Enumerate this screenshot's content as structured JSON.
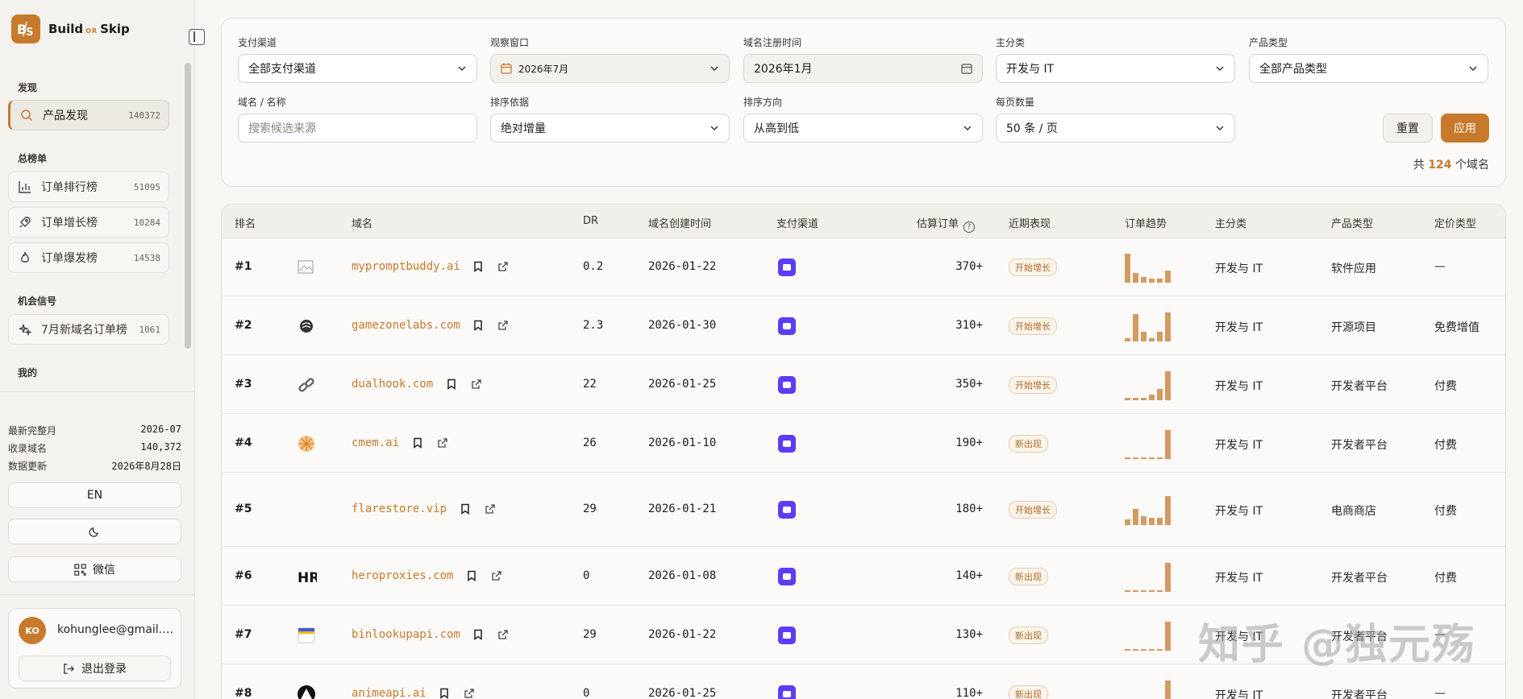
{
  "app": {
    "brand_build": "Build",
    "brand_or": "OR",
    "brand_skip": "Skip"
  },
  "sidebar": {
    "sections": [
      {
        "title": "发现",
        "items": [
          {
            "label": "产品发现",
            "count": "140372",
            "icon": "search-icon",
            "active": true
          }
        ]
      },
      {
        "title": "总榜单",
        "items": [
          {
            "label": "订单排行榜",
            "count": "51095",
            "icon": "bar-chart-icon"
          },
          {
            "label": "订单增长榜",
            "count": "10284",
            "icon": "rocket-icon"
          },
          {
            "label": "订单爆发榜",
            "count": "14538",
            "icon": "flame-icon"
          }
        ]
      },
      {
        "title": "机会信号",
        "items": [
          {
            "label": "7月新域名订单榜",
            "count": "1061",
            "icon": "sparkles-icon"
          }
        ]
      },
      {
        "title": "我的",
        "items": []
      }
    ],
    "meta": [
      {
        "label": "最新完整月",
        "value": "2026-07"
      },
      {
        "label": "收录域名",
        "value": "140,372"
      },
      {
        "label": "数据更新",
        "value": "2026年8月28日"
      }
    ],
    "lang_button": "EN",
    "wechat_button": "微信",
    "user": {
      "initials": "KO",
      "email": "kohunglee@gmail.c...",
      "logout": "退出登录"
    }
  },
  "filters": {
    "payment": {
      "label": "支付渠道",
      "value": "全部支付渠道"
    },
    "window": {
      "label": "观察窗口",
      "value": "2026年7月"
    },
    "reg_time": {
      "label": "域名注册时间",
      "value": "2026年1月"
    },
    "category": {
      "label": "主分类",
      "value": "开发与 IT"
    },
    "product_type": {
      "label": "产品类型",
      "value": "全部产品类型"
    },
    "name": {
      "label": "域名 / 名称",
      "placeholder": "搜索候选来源"
    },
    "sort_by": {
      "label": "排序依据",
      "value": "绝对增量"
    },
    "sort_dir": {
      "label": "排序方向",
      "value": "从高到低"
    },
    "page_size": {
      "label": "每页数量",
      "value": "50 条 / 页"
    },
    "reset": "重置",
    "apply": "应用",
    "total_prefix": "共",
    "total_count": "124",
    "total_suffix": "个域名"
  },
  "table": {
    "columns": [
      "排名",
      "域名",
      "DR",
      "域名创建时间",
      "支付渠道",
      "估算订单",
      "近期表现",
      "订单趋势",
      "主分类",
      "产品类型",
      "定价类型"
    ],
    "rows": [
      {
        "rank": "#1",
        "domain": "mypromptbuddy.ai",
        "favicon": "broken-image-icon",
        "dr": "0.2",
        "created": "2026-01-22",
        "orders": "370+",
        "perf": "开始增长",
        "trend": [
          1.0,
          0.33,
          0.2,
          0.13,
          0.13,
          0.43
        ],
        "category": "开发与 IT",
        "ptype": "软件应用",
        "pricing": "—"
      },
      {
        "rank": "#2",
        "domain": "gamezonelabs.com",
        "favicon": "swirl-icon",
        "dr": "2.3",
        "created": "2026-01-30",
        "orders": "310+",
        "perf": "开始增长",
        "trend": [
          0.1,
          0.95,
          0.33,
          0.1,
          0.33,
          1.0
        ],
        "category": "开发与 IT",
        "ptype": "开源项目",
        "pricing": "免费增值"
      },
      {
        "rank": "#3",
        "domain": "dualhook.com",
        "favicon": "link-icon",
        "dr": "22",
        "created": "2026-01-25",
        "orders": "350+",
        "perf": "开始增长",
        "trend": [
          0.05,
          0.05,
          0.05,
          0.2,
          0.4,
          1.0
        ],
        "category": "开发与 IT",
        "ptype": "开发者平台",
        "pricing": "付费"
      },
      {
        "rank": "#4",
        "domain": "cmem.ai",
        "favicon": "sunburst-icon",
        "dr": "26",
        "created": "2026-01-10",
        "orders": "190+",
        "perf": "新出现",
        "trend": [
          0,
          0,
          0,
          0,
          0,
          1.0
        ],
        "category": "开发与 IT",
        "ptype": "开发者平台",
        "pricing": "付费"
      },
      {
        "rank": "#5",
        "domain": "flarestore.vip",
        "favicon": "",
        "dr": "29",
        "created": "2026-01-21",
        "orders": "180+",
        "perf": "开始增长",
        "trend": [
          0.2,
          0.55,
          0.3,
          0.25,
          0.25,
          1.0
        ],
        "category": "开发与 IT",
        "ptype": "电商商店",
        "pricing": "付费"
      },
      {
        "rank": "#6",
        "domain": "heroproxies.com",
        "favicon": "hero-logo-icon",
        "dr": "0",
        "created": "2026-01-08",
        "orders": "140+",
        "perf": "新出现",
        "trend": [
          0,
          0,
          0,
          0,
          0,
          1.0
        ],
        "category": "开发与 IT",
        "ptype": "开发者平台",
        "pricing": "付费"
      },
      {
        "rank": "#7",
        "domain": "binlookupapi.com",
        "favicon": "card-icon",
        "dr": "29",
        "created": "2026-01-22",
        "orders": "130+",
        "perf": "新出现",
        "trend": [
          0,
          0,
          0,
          0,
          0,
          1.0
        ],
        "category": "开发与 IT",
        "ptype": "开发者平台",
        "pricing": "—"
      },
      {
        "rank": "#8",
        "domain": "animeapi.ai",
        "favicon": "triangle-icon",
        "dr": "0",
        "created": "2026-01-25",
        "orders": "110+",
        "perf": "新出现",
        "trend": [
          0,
          0,
          0,
          0,
          0,
          1.0
        ],
        "category": "开发与 IT",
        "ptype": "开发者平台",
        "pricing": "—"
      }
    ]
  },
  "watermark": "知乎 @独元殇",
  "colors": {
    "accent": "#c77a2c",
    "payment": "#5b3df5",
    "spark": "#d49a61"
  }
}
